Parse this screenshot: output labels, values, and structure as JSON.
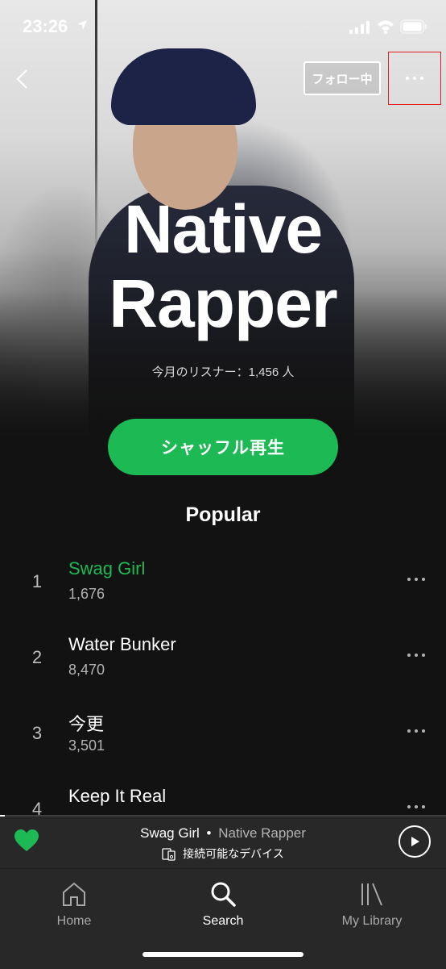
{
  "status_bar": {
    "time": "23:26"
  },
  "header": {
    "follow_label": "フォロー中"
  },
  "artist": {
    "name_line1": "Native",
    "name_line2": "Rapper",
    "monthly_listeners": "今月のリスナー：1,456 人"
  },
  "shuffle_label": "シャッフル再生",
  "popular": {
    "title": "Popular",
    "tracks": [
      {
        "rank": "1",
        "title": "Swag Girl",
        "plays": "1,676"
      },
      {
        "rank": "2",
        "title": "Water Bunker",
        "plays": "8,470"
      },
      {
        "rank": "3",
        "title": "今更",
        "plays": "3,501"
      },
      {
        "rank": "4",
        "title": "Keep It Real",
        "plays": ""
      }
    ]
  },
  "now_playing": {
    "song": "Swag Girl",
    "separator": "•",
    "artist": "Native Rapper",
    "device": "接続可能なデバイス",
    "progress": 0.01
  },
  "tabs": [
    {
      "label": "Home",
      "icon": "home-icon"
    },
    {
      "label": "Search",
      "icon": "search-icon"
    },
    {
      "label": "My Library",
      "icon": "library-icon"
    }
  ],
  "colors": {
    "accent": "#1db954",
    "background": "#121212",
    "bar": "#282828"
  }
}
